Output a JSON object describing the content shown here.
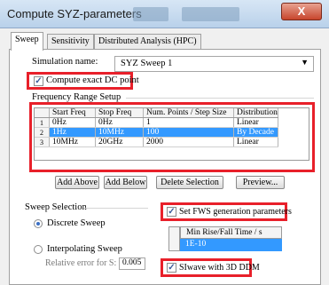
{
  "window": {
    "title": "Compute SYZ-parameters",
    "close_label": "X"
  },
  "tabs": [
    "Sweep",
    "Sensitivity",
    "Distributed Analysis (HPC)"
  ],
  "simulation": {
    "name_label": "Simulation name:",
    "name_value": "SYZ Sweep 1"
  },
  "dc_point": {
    "label": "Compute exact DC point",
    "checked": true
  },
  "frequency": {
    "group_label": "Frequency Range Setup",
    "columns": [
      "Start Freq",
      "Stop Freq",
      "Num. Points / Step Size",
      "Distribution"
    ],
    "rows": [
      {
        "index": "1",
        "start": "0Hz",
        "stop": "0Hz",
        "points": "1",
        "distribution": "Linear"
      },
      {
        "index": "2",
        "start": "1Hz",
        "stop": "10MHz",
        "points": "100",
        "distribution": "By Decade"
      },
      {
        "index": "3",
        "start": "10MHz",
        "stop": "20GHz",
        "points": "2000",
        "distribution": "Linear"
      }
    ],
    "selected_row": 1
  },
  "buttons": {
    "add_above": "Add Above",
    "add_below": "Add Below",
    "delete_selection": "Delete Selection",
    "preview": "Preview..."
  },
  "sweep_selection": {
    "group_label": "Sweep Selection",
    "discrete_label": "Discrete Sweep",
    "interpolating_label": "Interpolating Sweep",
    "relative_error_label": "Relative error for S:",
    "relative_error_value": "0.005",
    "selected": "discrete"
  },
  "fws": {
    "label": "Set FWS generation parameters",
    "checked": true,
    "column": "Min Rise/Fall Time / s",
    "value": "1E-10"
  },
  "siwave": {
    "label": "SIwave with 3D DDM",
    "checked": true
  },
  "colors": {
    "highlight": "#e8202a",
    "selection": "#3399ff"
  }
}
